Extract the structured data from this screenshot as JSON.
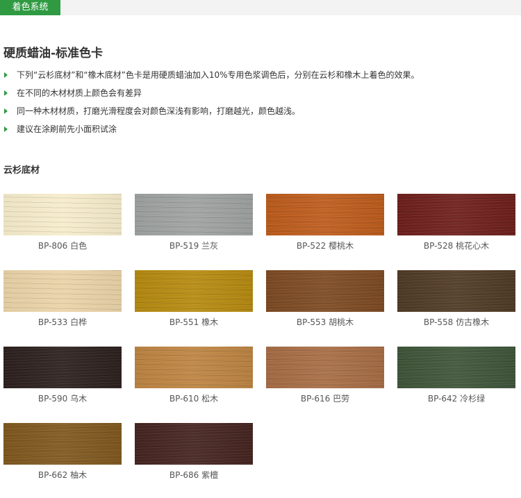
{
  "header": {
    "tab_label": "着色系统"
  },
  "title": "硬质蜡油-标准色卡",
  "bullets": [
    "下列“云杉底材”和“橡木底材”色卡是用硬质蜡油加入10%专用色浆调色后，分别在云杉和橡木上着色的效果。",
    "在不同的木材材质上颜色会有差异",
    "同一种木材材质，打磨光滑程度会对颜色深浅有影响，打磨越光，颜色越浅。",
    "建议在涂刷前先小面积试涂"
  ],
  "section_title": "云杉底材",
  "colors": {
    "accent": "#2f9a42"
  },
  "swatches": [
    {
      "label": "BP-806 白色",
      "color": "#f6eccb"
    },
    {
      "label": "BP-519 兰灰",
      "color": "#9ea2a0"
    },
    {
      "label": "BP-522 樱桃木",
      "color": "#bd5c1c"
    },
    {
      "label": "BP-528 桃花心木",
      "color": "#6e1f1b"
    },
    {
      "label": "BP-533 白桦",
      "color": "#ead3a8"
    },
    {
      "label": "BP-551 橡木",
      "color": "#b68a10"
    },
    {
      "label": "BP-553 胡桃木",
      "color": "#7d4a22"
    },
    {
      "label": "BP-558 仿古橡木",
      "color": "#4f3a25"
    },
    {
      "label": "BP-590 乌木",
      "color": "#2c201d"
    },
    {
      "label": "BP-610 松木",
      "color": "#bd8442"
    },
    {
      "label": "BP-616 巴劳",
      "color": "#a76d45"
    },
    {
      "label": "BP-642 冷杉绿",
      "color": "#3e5539"
    },
    {
      "label": "BP-662 柚木",
      "color": "#80581e"
    },
    {
      "label": "BP-686 紫檀",
      "color": "#45241f"
    }
  ]
}
